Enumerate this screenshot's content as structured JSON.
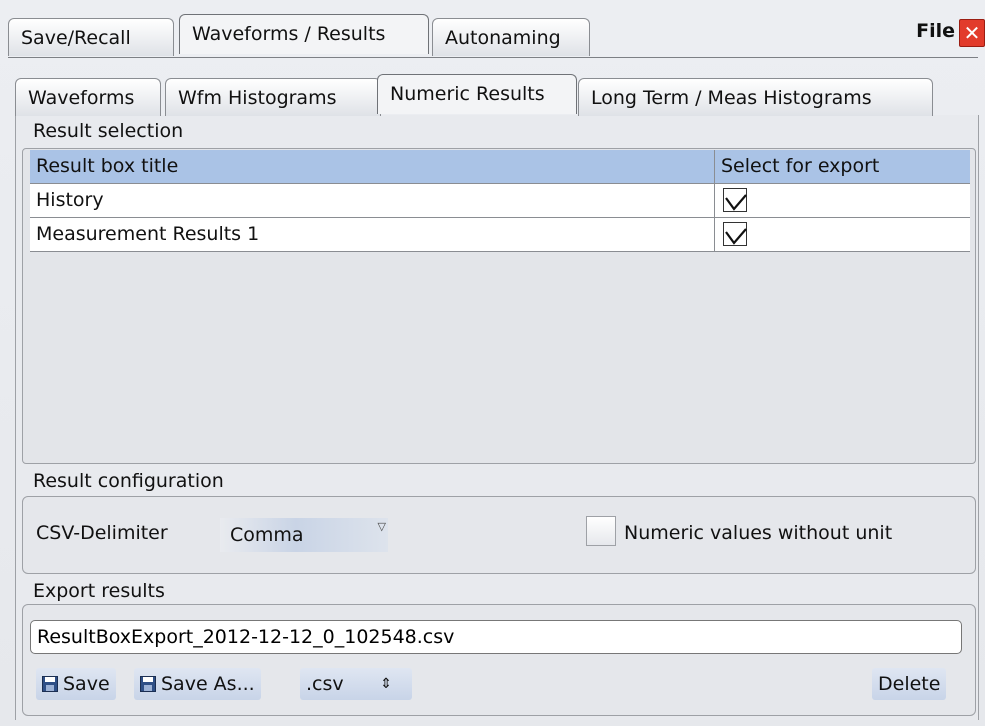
{
  "window": {
    "file_label": "File",
    "close_glyph": "✕"
  },
  "top_tabs": [
    {
      "label": "Save/Recall",
      "active": false
    },
    {
      "label": "Waveforms / Results",
      "active": true
    },
    {
      "label": "Autonaming",
      "active": false
    }
  ],
  "sub_tabs": [
    {
      "label": "Waveforms",
      "active": false
    },
    {
      "label": "Wfm Histograms",
      "active": false
    },
    {
      "label": "Numeric Results",
      "active": true
    },
    {
      "label": "Long Term / Meas Histograms",
      "active": false
    }
  ],
  "result_selection": {
    "section_label": "Result selection",
    "columns": [
      "Result box title",
      "Select for export"
    ],
    "rows": [
      {
        "title": "History",
        "selected": true
      },
      {
        "title": "Measurement Results 1",
        "selected": true
      }
    ]
  },
  "result_configuration": {
    "section_label": "Result configuration",
    "delimiter_label": "CSV-Delimiter",
    "delimiter_value": "Comma",
    "unit_checkbox_label": "Numeric values without unit",
    "unit_checkbox_checked": false
  },
  "export_results": {
    "section_label": "Export results",
    "filename": "ResultBoxExport_2012-12-12_0_102548.csv",
    "save_label": "Save",
    "save_as_label": "Save As...",
    "format_value": ".csv",
    "delete_label": "Delete"
  },
  "colors": {
    "header_blue": "#aac3e6",
    "close_red": "#e23b2b",
    "panel_bg": "#e8eaee"
  },
  "icons": [
    "close-icon",
    "checkmark-icon",
    "dropdown-arrow-icon",
    "floppy-disk-icon",
    "spinner-icon"
  ]
}
